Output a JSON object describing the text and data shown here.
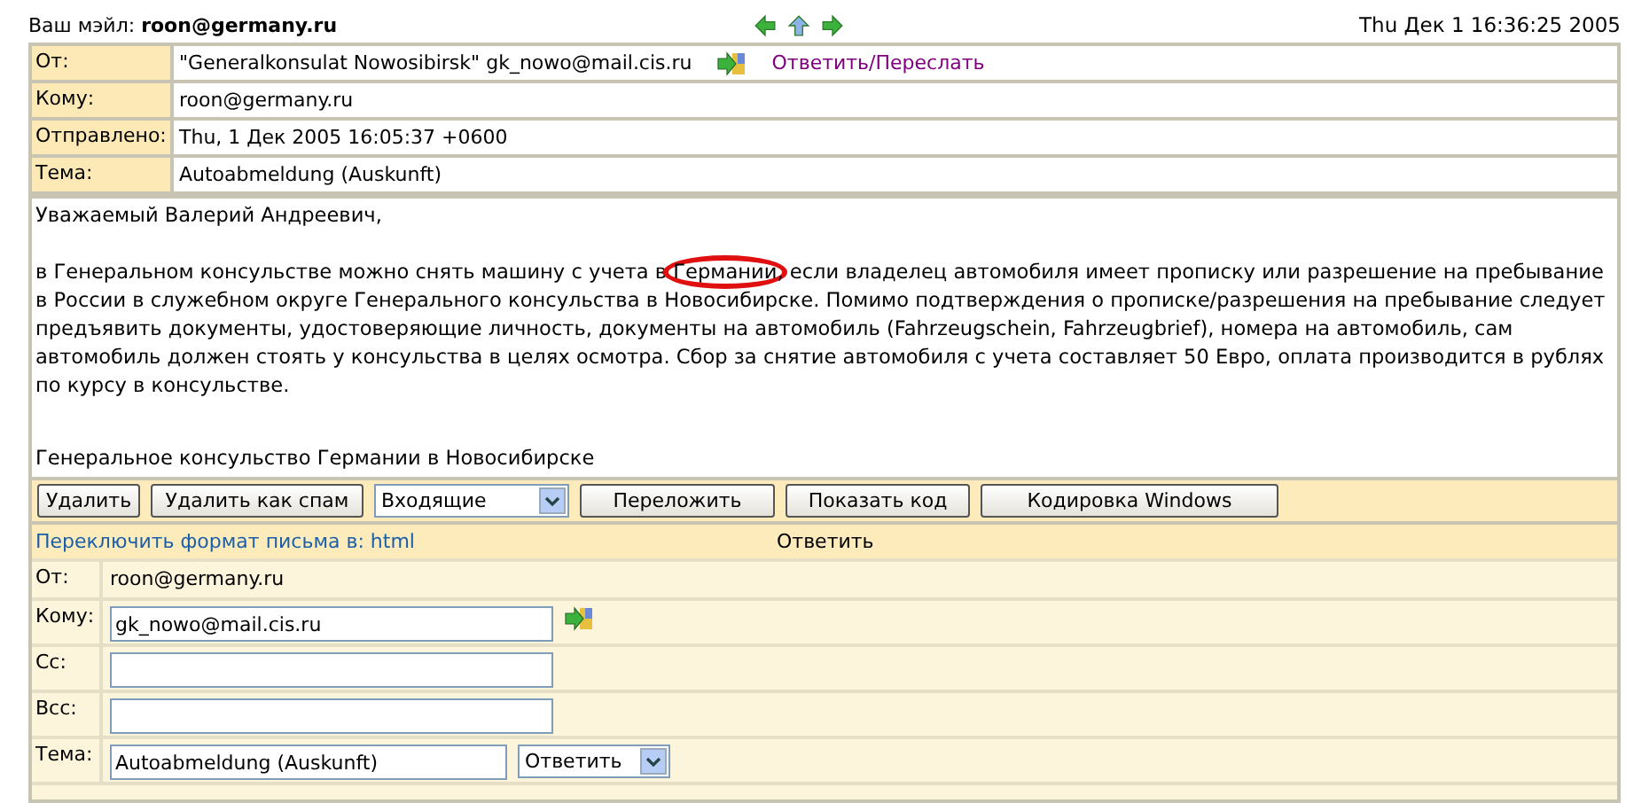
{
  "header": {
    "label": "Ваш мэйл:",
    "email": "roon@germany.ru",
    "datetime": "Thu Дек 1 16:36:25 2005"
  },
  "nav_icons": [
    {
      "kind": "left"
    },
    {
      "kind": "up"
    },
    {
      "kind": "right"
    }
  ],
  "message_headers": [
    {
      "label": "От:",
      "value": "\"Generalkonsulat Nowosibirsk\" gk_nowo@mail.cis.ru",
      "action": "Ответить/Переслать"
    },
    {
      "label": "Кому:",
      "value": "roon@germany.ru"
    },
    {
      "label": "Отправлено:",
      "value": "Thu, 1 Дек 2005 16:05:37 +0600"
    },
    {
      "label": "Тема:",
      "value": "Autoabmeldung (Auskunft)"
    }
  ],
  "body": {
    "greeting": "Уважаемый Валерий Андреевич,",
    "paragraph": [
      {
        "text": "в Генеральном консульстве можно снять машину с учета в ",
        "circled": false
      },
      {
        "text": "Германии",
        "circled": true
      },
      {
        "text": ", если владелец автомобиля имеет прописку или разрешение на пребывание в России в служебном округе Генерального консульства в Новосибирске. Помимо подтверждения о прописке/разрешения на пребывание следует предъявить документы, удостоверяющие личность, документы на автомобиль (Fahrzeugschein, Fahrzeugbrief), номера на автомобиль, сам автомобиль должен стоять у консульства в целях осмотра. Сбор за снятие автомобиля с учета составляет 50 Евро, оплата производится в рублях по курсу в консульстве.",
        "circled": false
      }
    ],
    "signature": "Генеральное консульство Германии в Новосибирске"
  },
  "toolbar": [
    {
      "kind": "button",
      "label": "Удалить"
    },
    {
      "kind": "button",
      "label": "Удалить как спам"
    },
    {
      "kind": "select",
      "label": "Входящие"
    },
    {
      "kind": "button",
      "label": "Переложить"
    },
    {
      "kind": "button",
      "label": "Показать код"
    },
    {
      "kind": "button",
      "label": "Кодировка Windows"
    }
  ],
  "reply": {
    "format_link": "Переключить формат письма в: html",
    "title": "Ответить",
    "fields": [
      {
        "kind": "text",
        "label": "От:",
        "value": "roon@germany.ru"
      },
      {
        "kind": "input",
        "label": "Кому:",
        "value": "gk_nowo@mail.cis.ru",
        "address_book": true
      },
      {
        "kind": "input",
        "label": "Cc:"
      },
      {
        "kind": "input",
        "label": "Bcc:"
      },
      {
        "kind": "subject",
        "label": "Тема:",
        "value": "Autoabmeldung (Auskunft)",
        "select": "Ответить"
      }
    ]
  }
}
